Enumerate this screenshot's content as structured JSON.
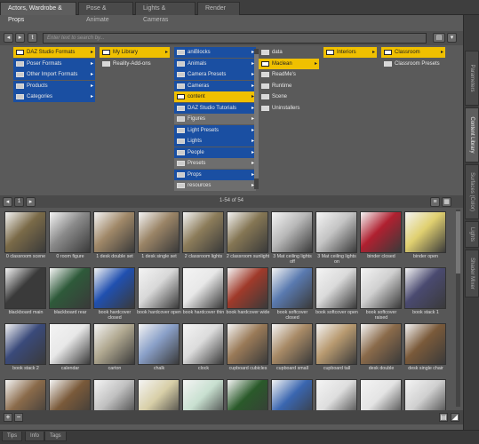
{
  "tabs": [
    "Actors, Wardrobe & Props",
    "Pose & Animate",
    "Lights & Cameras",
    "Render"
  ],
  "right_tabs": [
    "Parameters",
    "Content Library",
    "Surfaces (Color)",
    "Lights",
    "Shader Mixer"
  ],
  "toolbar": {
    "back": "◂",
    "forward": "▸",
    "tag_icon": "t",
    "search_placeholder": "Enter text to search by..."
  },
  "columns": {
    "col1": [
      {
        "label": "DAZ Studio Formats",
        "style": "yellow"
      },
      {
        "label": "Poser Formats",
        "style": "blue"
      },
      {
        "label": "Other Import Formats",
        "style": "blue"
      },
      {
        "label": "Products",
        "style": "blue"
      },
      {
        "label": "Categories",
        "style": "blue"
      }
    ],
    "col2": [
      {
        "label": "My Library",
        "style": "yellow"
      },
      {
        "label": "Reality-Add-ons",
        "style": "plain"
      }
    ],
    "col3": [
      {
        "label": "aniBlocks",
        "style": "blue"
      },
      {
        "label": "Animals",
        "style": "blue"
      },
      {
        "label": "Camera Presets",
        "style": "blue"
      },
      {
        "label": "Cameras",
        "style": "blue"
      },
      {
        "label": "content",
        "style": "yellow"
      },
      {
        "label": "DAZ Studio Tutorials",
        "style": "blue"
      },
      {
        "label": "Figures",
        "style": "grey"
      },
      {
        "label": "Light Presets",
        "style": "blue"
      },
      {
        "label": "Lights",
        "style": "blue"
      },
      {
        "label": "People",
        "style": "blue"
      },
      {
        "label": "Presets",
        "style": "grey"
      },
      {
        "label": "Props",
        "style": "blue"
      },
      {
        "label": "resources",
        "style": "grey"
      }
    ],
    "col4": [
      {
        "label": "data",
        "style": "plain"
      },
      {
        "label": "Maclean",
        "style": "yellow"
      },
      {
        "label": "ReadMe's",
        "style": "plain"
      },
      {
        "label": "Runtime",
        "style": "plain"
      },
      {
        "label": "Scene",
        "style": "plain"
      },
      {
        "label": "Uninstallers",
        "style": "plain"
      }
    ],
    "col5": [
      {
        "label": "Interiors",
        "style": "yellow"
      }
    ],
    "col6": [
      {
        "label": "Classroom",
        "style": "yellow"
      },
      {
        "label": "Classroom Presets",
        "style": "plain"
      }
    ]
  },
  "paging": {
    "page": "1",
    "info": "1-54 of 54"
  },
  "thumbnails": [
    {
      "label": "0 classroom scene",
      "color": "#7a6a48"
    },
    {
      "label": "0 room figure",
      "color": "#8a8a8a"
    },
    {
      "label": "1 desk double set",
      "color": "#a08868"
    },
    {
      "label": "1 desk single set",
      "color": "#9a8466"
    },
    {
      "label": "2 classroom lights",
      "color": "#8c7c5a"
    },
    {
      "label": "2 classroom sunlight",
      "color": "#857654"
    },
    {
      "label": "3 Mat ceiling lights off",
      "color": "#b8b8b8"
    },
    {
      "label": "3 Mat ceiling lights on",
      "color": "#c4c4c4"
    },
    {
      "label": "binder closed",
      "color": "#b02030"
    },
    {
      "label": "binder open",
      "color": "#e0d070"
    },
    {
      "label": "blackboard main",
      "color": "#3a3a3a"
    },
    {
      "label": "blackboard rear",
      "color": "#2e5a3a"
    },
    {
      "label": "book hardcover closed",
      "color": "#2050b0"
    },
    {
      "label": "book hardcover open",
      "color": "#d8d8d8"
    },
    {
      "label": "book hardcover thin",
      "color": "#e8e8e8"
    },
    {
      "label": "book hardcover wide",
      "color": "#a03a2a"
    },
    {
      "label": "book softcover closed",
      "color": "#5a7ab0"
    },
    {
      "label": "book softcover open",
      "color": "#dadada"
    },
    {
      "label": "book softcover raised",
      "color": "#d0d0d0"
    },
    {
      "label": "book stack 1",
      "color": "#4a4a70"
    },
    {
      "label": "book stack 2",
      "color": "#3a4a7a"
    },
    {
      "label": "calendar",
      "color": "#e8e8e8"
    },
    {
      "label": "carton",
      "color": "#b0a890"
    },
    {
      "label": "chalk",
      "color": "#8aa0c8"
    },
    {
      "label": "clock",
      "color": "#dcdcdc"
    },
    {
      "label": "cupboard cubicles",
      "color": "#9a7a58"
    },
    {
      "label": "cupboard small",
      "color": "#a88a66"
    },
    {
      "label": "cupboard tall",
      "color": "#b89a70"
    },
    {
      "label": "desk double",
      "color": "#8a6a4a"
    },
    {
      "label": "desk single chair",
      "color": "#7a5a3a"
    },
    {
      "label": "",
      "color": "#8a6a4a"
    },
    {
      "label": "",
      "color": "#7a5a3a"
    },
    {
      "label": "",
      "color": "#c0c0c0"
    },
    {
      "label": "",
      "color": "#d8cfa8"
    },
    {
      "label": "",
      "color": "#c8e0d0"
    },
    {
      "label": "",
      "color": "#2a5a2a"
    },
    {
      "label": "",
      "color": "#3a66b0"
    },
    {
      "label": "",
      "color": "#dedede"
    },
    {
      "label": "",
      "color": "#e4e4e4"
    },
    {
      "label": "",
      "color": "#d0d0d0"
    }
  ],
  "bottom": {
    "add": "+",
    "remove": "−"
  },
  "status_tabs": [
    "Tips",
    "Info",
    "Tags"
  ]
}
